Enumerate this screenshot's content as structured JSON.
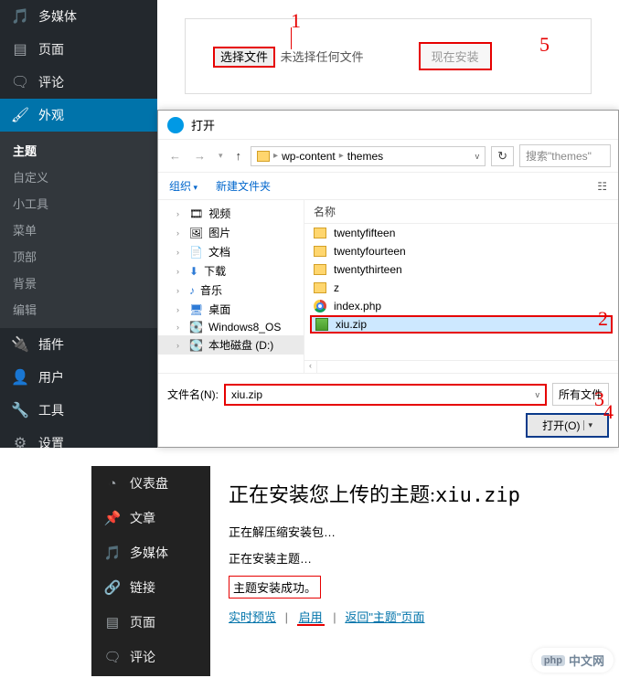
{
  "wp_sidebar": {
    "items": [
      {
        "icon": "media",
        "label": "多媒体"
      },
      {
        "icon": "page",
        "label": "页面"
      },
      {
        "icon": "comment",
        "label": "评论"
      },
      {
        "icon": "appearance",
        "label": "外观"
      },
      {
        "icon": "plugin",
        "label": "插件"
      },
      {
        "icon": "user",
        "label": "用户"
      },
      {
        "icon": "tool",
        "label": "工具"
      },
      {
        "icon": "setting",
        "label": "设置"
      }
    ],
    "appearance_sub": [
      "主题",
      "自定义",
      "小工具",
      "菜单",
      "顶部",
      "背景",
      "编辑"
    ]
  },
  "upload": {
    "choose_label": "选择文件",
    "no_file_label": "未选择任何文件",
    "install_label": "现在安装"
  },
  "dialog": {
    "title": "打开",
    "path_segments": [
      "wp-content",
      "themes"
    ],
    "search_placeholder": "搜索\"themes\"",
    "toolbar_organize": "组织",
    "toolbar_newfolder": "新建文件夹",
    "tree": [
      {
        "label": "视频"
      },
      {
        "label": "图片"
      },
      {
        "label": "文档"
      },
      {
        "label": "下载"
      },
      {
        "label": "音乐"
      },
      {
        "label": "桌面"
      },
      {
        "label": "Windows8_OS"
      },
      {
        "label": "本地磁盘 (D:)"
      }
    ],
    "list_header": "名称",
    "files": [
      {
        "type": "folder",
        "name": "twentyfifteen"
      },
      {
        "type": "folder",
        "name": "twentyfourteen"
      },
      {
        "type": "folder",
        "name": "twentythirteen"
      },
      {
        "type": "folder",
        "name": "z"
      },
      {
        "type": "chrome",
        "name": "index.php"
      },
      {
        "type": "zip",
        "name": "xiu.zip",
        "selected": true
      }
    ],
    "filename_label": "文件名(N):",
    "filename_value": "xiu.zip",
    "filetype_label": "所有文件",
    "open_label": "打开(O)"
  },
  "annotations": {
    "a1": "1",
    "a2": "2",
    "a3": "3",
    "a4": "4",
    "a5": "5"
  },
  "wp_sidebar2": {
    "items": [
      {
        "icon": "dash",
        "label": "仪表盘"
      },
      {
        "icon": "pin",
        "label": "文章"
      },
      {
        "icon": "media",
        "label": "多媒体"
      },
      {
        "icon": "link",
        "label": "链接"
      },
      {
        "icon": "page",
        "label": "页面"
      },
      {
        "icon": "comment",
        "label": "评论"
      }
    ]
  },
  "result": {
    "title_prefix": "正在安装您上传的主题:",
    "zip_name": "xiu.zip",
    "line1": "正在解压缩安装包…",
    "line2": "正在安装主题…",
    "line3": "主题安装成功。",
    "link_preview": "实时预览",
    "link_enable": "启用",
    "link_return": "返回\"主题\"页面"
  },
  "watermark": {
    "tag": "php",
    "text": "中文网"
  }
}
